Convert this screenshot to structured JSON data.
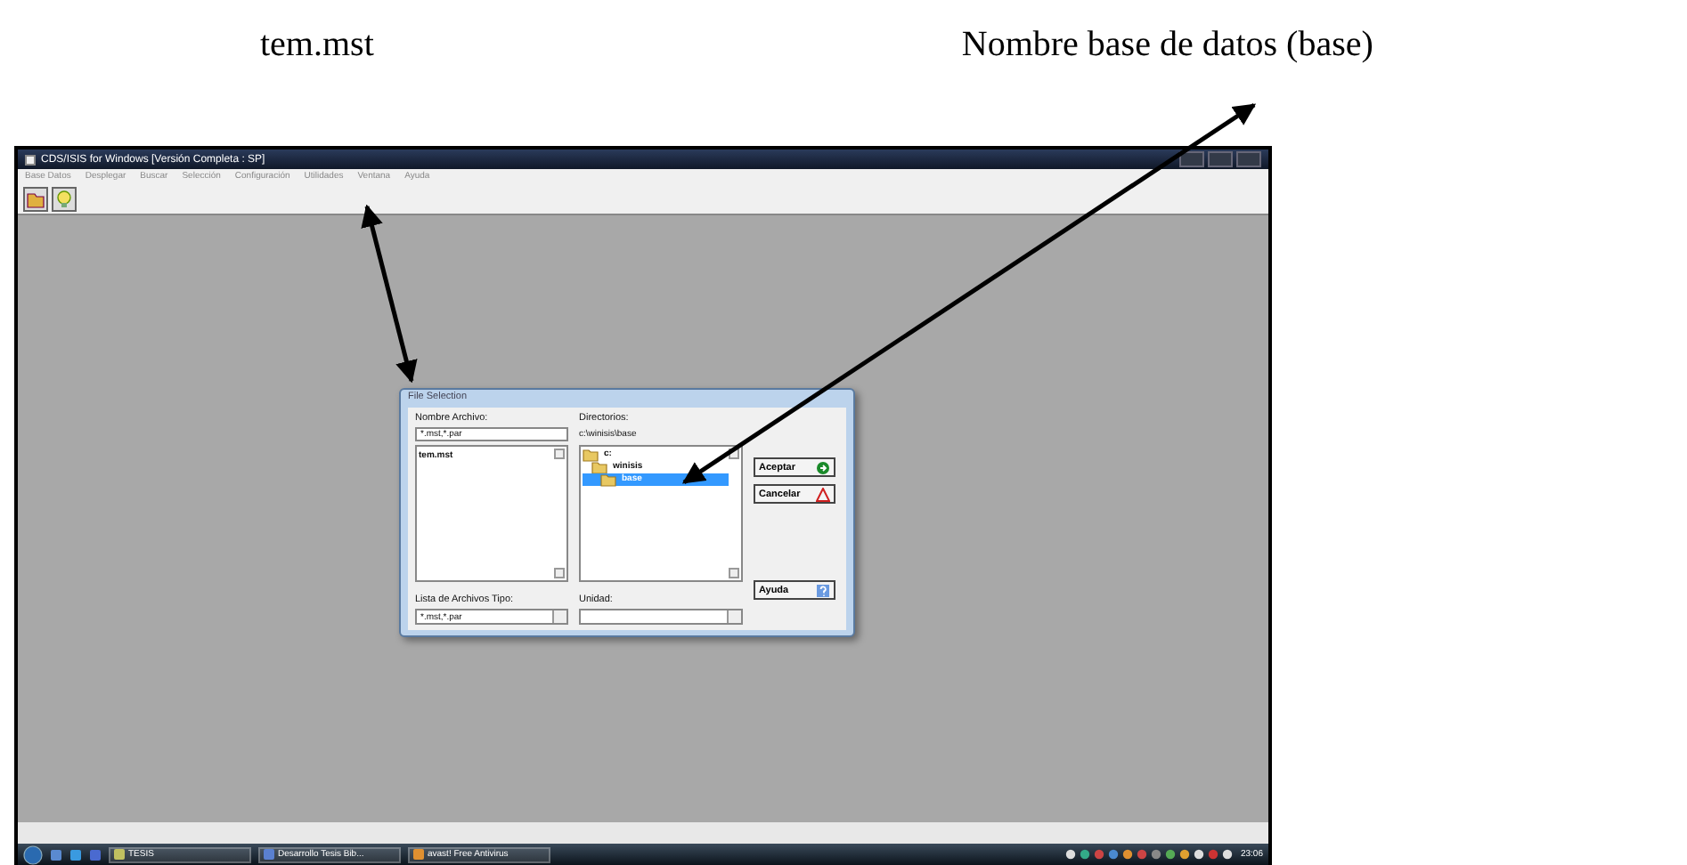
{
  "annotations": [
    {
      "text": "tem.mst"
    },
    {
      "text": "Nombre base de datos (base)"
    }
  ],
  "window": {
    "title": "CDS/ISIS for Windows [Versión Completa : SP]",
    "menu": [
      "Base Datos",
      "Desplegar",
      "Buscar",
      "Selección",
      "Configuración",
      "Utilidades",
      "Ventana",
      "Ayuda"
    ]
  },
  "dialog": {
    "title": "File Selection",
    "file_name_label": "Nombre Archivo:",
    "file_name_value": "*.mst,*.par",
    "files": [
      {
        "name": "tem.mst",
        "selected": false
      }
    ],
    "directories_label": "Directorios:",
    "current_path": "c:\\winisis\\base",
    "folders": [
      {
        "name": "c:",
        "selected": false,
        "children": [
          {
            "name": "winisis",
            "selected": false,
            "children": [
              {
                "name": "base",
                "selected": true
              }
            ]
          }
        ]
      }
    ],
    "buttons": [
      {
        "label": "Aceptar",
        "kind": "ok"
      },
      {
        "label": "Cancelar",
        "kind": "cancel"
      },
      {
        "label": "Ayuda",
        "kind": "help"
      }
    ],
    "file_type_label": "Lista de Archivos Tipo:",
    "file_type_value": "*.mst,*.par",
    "drive_label": "Unidad:"
  },
  "taskbar": {
    "items": [
      {
        "label": "TESIS"
      },
      {
        "label": "Desarrollo Tesis Bib..."
      },
      {
        "label": "avast! Free Antivirus"
      }
    ],
    "clock": "23:06"
  }
}
